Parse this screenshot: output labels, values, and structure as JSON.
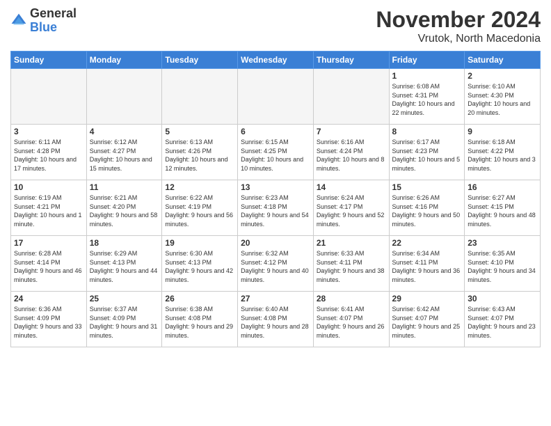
{
  "logo": {
    "general": "General",
    "blue": "Blue"
  },
  "title": "November 2024",
  "subtitle": "Vrutok, North Macedonia",
  "headers": [
    "Sunday",
    "Monday",
    "Tuesday",
    "Wednesday",
    "Thursday",
    "Friday",
    "Saturday"
  ],
  "weeks": [
    [
      {
        "day": "",
        "info": ""
      },
      {
        "day": "",
        "info": ""
      },
      {
        "day": "",
        "info": ""
      },
      {
        "day": "",
        "info": ""
      },
      {
        "day": "",
        "info": ""
      },
      {
        "day": "1",
        "info": "Sunrise: 6:08 AM\nSunset: 4:31 PM\nDaylight: 10 hours and 22 minutes."
      },
      {
        "day": "2",
        "info": "Sunrise: 6:10 AM\nSunset: 4:30 PM\nDaylight: 10 hours and 20 minutes."
      }
    ],
    [
      {
        "day": "3",
        "info": "Sunrise: 6:11 AM\nSunset: 4:28 PM\nDaylight: 10 hours and 17 minutes."
      },
      {
        "day": "4",
        "info": "Sunrise: 6:12 AM\nSunset: 4:27 PM\nDaylight: 10 hours and 15 minutes."
      },
      {
        "day": "5",
        "info": "Sunrise: 6:13 AM\nSunset: 4:26 PM\nDaylight: 10 hours and 12 minutes."
      },
      {
        "day": "6",
        "info": "Sunrise: 6:15 AM\nSunset: 4:25 PM\nDaylight: 10 hours and 10 minutes."
      },
      {
        "day": "7",
        "info": "Sunrise: 6:16 AM\nSunset: 4:24 PM\nDaylight: 10 hours and 8 minutes."
      },
      {
        "day": "8",
        "info": "Sunrise: 6:17 AM\nSunset: 4:23 PM\nDaylight: 10 hours and 5 minutes."
      },
      {
        "day": "9",
        "info": "Sunrise: 6:18 AM\nSunset: 4:22 PM\nDaylight: 10 hours and 3 minutes."
      }
    ],
    [
      {
        "day": "10",
        "info": "Sunrise: 6:19 AM\nSunset: 4:21 PM\nDaylight: 10 hours and 1 minute."
      },
      {
        "day": "11",
        "info": "Sunrise: 6:21 AM\nSunset: 4:20 PM\nDaylight: 9 hours and 58 minutes."
      },
      {
        "day": "12",
        "info": "Sunrise: 6:22 AM\nSunset: 4:19 PM\nDaylight: 9 hours and 56 minutes."
      },
      {
        "day": "13",
        "info": "Sunrise: 6:23 AM\nSunset: 4:18 PM\nDaylight: 9 hours and 54 minutes."
      },
      {
        "day": "14",
        "info": "Sunrise: 6:24 AM\nSunset: 4:17 PM\nDaylight: 9 hours and 52 minutes."
      },
      {
        "day": "15",
        "info": "Sunrise: 6:26 AM\nSunset: 4:16 PM\nDaylight: 9 hours and 50 minutes."
      },
      {
        "day": "16",
        "info": "Sunrise: 6:27 AM\nSunset: 4:15 PM\nDaylight: 9 hours and 48 minutes."
      }
    ],
    [
      {
        "day": "17",
        "info": "Sunrise: 6:28 AM\nSunset: 4:14 PM\nDaylight: 9 hours and 46 minutes."
      },
      {
        "day": "18",
        "info": "Sunrise: 6:29 AM\nSunset: 4:13 PM\nDaylight: 9 hours and 44 minutes."
      },
      {
        "day": "19",
        "info": "Sunrise: 6:30 AM\nSunset: 4:13 PM\nDaylight: 9 hours and 42 minutes."
      },
      {
        "day": "20",
        "info": "Sunrise: 6:32 AM\nSunset: 4:12 PM\nDaylight: 9 hours and 40 minutes."
      },
      {
        "day": "21",
        "info": "Sunrise: 6:33 AM\nSunset: 4:11 PM\nDaylight: 9 hours and 38 minutes."
      },
      {
        "day": "22",
        "info": "Sunrise: 6:34 AM\nSunset: 4:11 PM\nDaylight: 9 hours and 36 minutes."
      },
      {
        "day": "23",
        "info": "Sunrise: 6:35 AM\nSunset: 4:10 PM\nDaylight: 9 hours and 34 minutes."
      }
    ],
    [
      {
        "day": "24",
        "info": "Sunrise: 6:36 AM\nSunset: 4:09 PM\nDaylight: 9 hours and 33 minutes."
      },
      {
        "day": "25",
        "info": "Sunrise: 6:37 AM\nSunset: 4:09 PM\nDaylight: 9 hours and 31 minutes."
      },
      {
        "day": "26",
        "info": "Sunrise: 6:38 AM\nSunset: 4:08 PM\nDaylight: 9 hours and 29 minutes."
      },
      {
        "day": "27",
        "info": "Sunrise: 6:40 AM\nSunset: 4:08 PM\nDaylight: 9 hours and 28 minutes."
      },
      {
        "day": "28",
        "info": "Sunrise: 6:41 AM\nSunset: 4:07 PM\nDaylight: 9 hours and 26 minutes."
      },
      {
        "day": "29",
        "info": "Sunrise: 6:42 AM\nSunset: 4:07 PM\nDaylight: 9 hours and 25 minutes."
      },
      {
        "day": "30",
        "info": "Sunrise: 6:43 AM\nSunset: 4:07 PM\nDaylight: 9 hours and 23 minutes."
      }
    ]
  ]
}
